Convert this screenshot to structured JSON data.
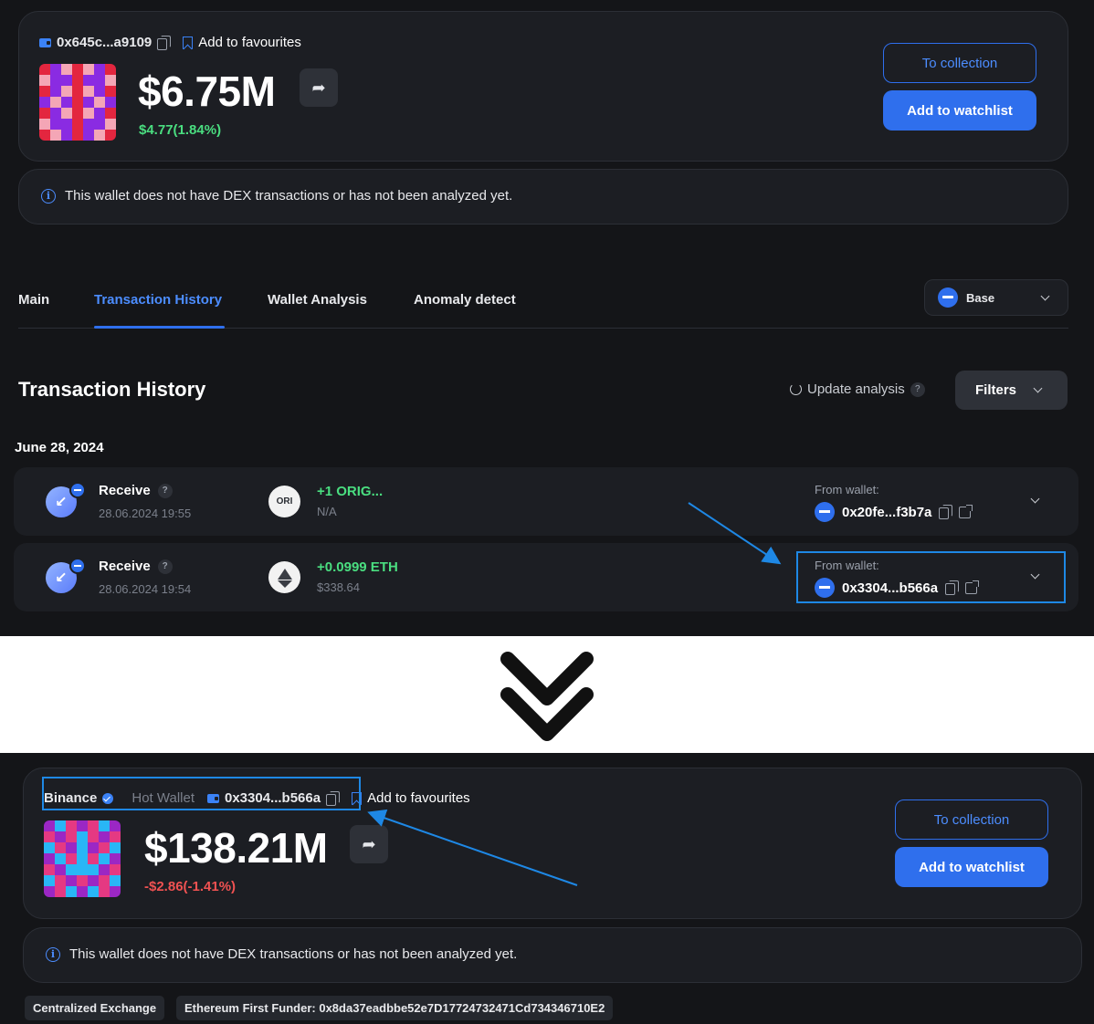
{
  "before": {
    "address": "0x645c...a9109",
    "add_favourites": "Add to favourites",
    "value": "$6.75M",
    "change": "$4.77(1.84%)",
    "to_collection": "To collection",
    "add_watchlist": "Add to watchlist",
    "notice": "This wallet does not have DEX transactions or has not been analyzed yet.",
    "tabs": [
      "Main",
      "Transaction History",
      "Wallet Analysis",
      "Anomaly detect"
    ],
    "active_tab": "Transaction History",
    "chain": "Base",
    "section_title": "Transaction History",
    "update_analysis": "Update analysis",
    "filters": "Filters",
    "date": "June 28, 2024",
    "transactions": [
      {
        "type": "Receive",
        "time": "28.06.2024 19:55",
        "token_logo": "ORI",
        "amount": "+1 ORIG...",
        "usd": "N/A",
        "from_label": "From wallet:",
        "from_address": "0x20fe...f3b7a"
      },
      {
        "type": "Receive",
        "time": "28.06.2024 19:54",
        "token_logo": "eth-icon",
        "amount": "+0.0999 ETH",
        "usd": "$338.64",
        "from_label": "From wallet:",
        "from_address": "0x3304...b566a"
      }
    ]
  },
  "after": {
    "entity": "Binance",
    "wallet_type": "Hot Wallet",
    "address": "0x3304...b566a",
    "add_favourites": "Add to favourites",
    "value": "$138.21M",
    "change": "-$2.86(-1.41%)",
    "to_collection": "To collection",
    "add_watchlist": "Add to watchlist",
    "notice": "This wallet does not have DEX transactions or has not been analyzed yet.",
    "tags": [
      "Centralized Exchange",
      "Ethereum First Funder: 0x8da37eadbbe52e7D17724732471Cd734346710E2"
    ]
  },
  "colors": {
    "accent": "#2f6fed",
    "positive": "#4ade80",
    "negative": "#f05252",
    "highlight": "#1e88e5",
    "background": "#141518",
    "card": "#1c1e23"
  }
}
